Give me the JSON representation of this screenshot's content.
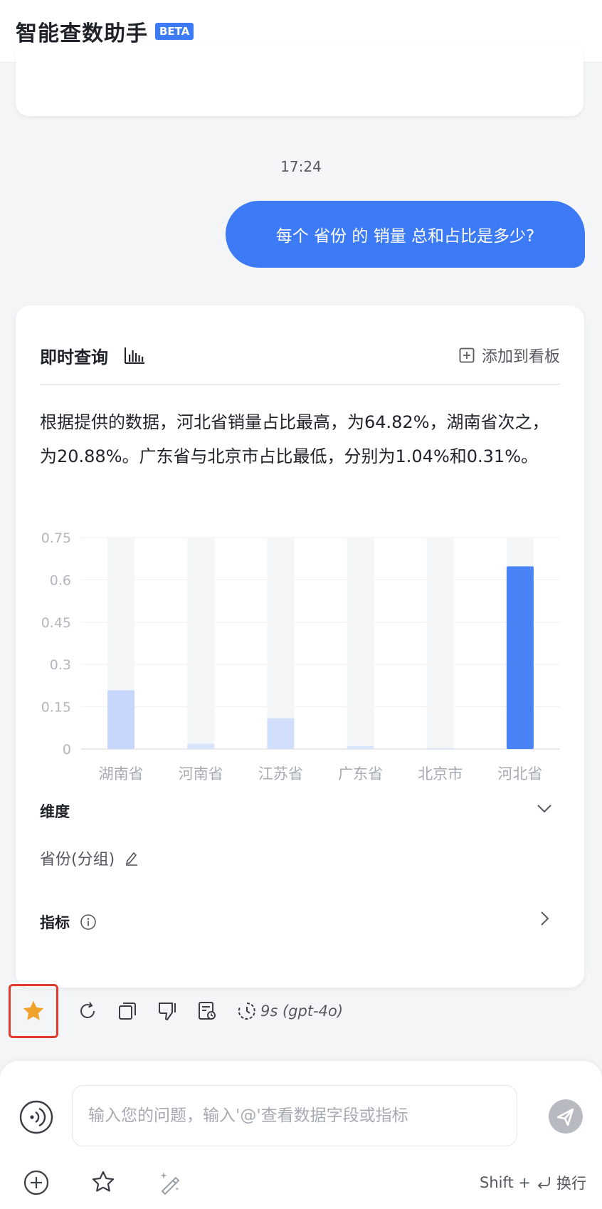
{
  "header": {
    "title": "智能查数助手",
    "badge": "BETA"
  },
  "conversation": {
    "timestamp": "17:24",
    "user_message": "每个 省份 的 销量 总和占比是多少?"
  },
  "answer_card": {
    "title": "即时查询",
    "title_icon": "bar-chart-icon",
    "add_to_board": "添加到看板",
    "summary": "根据提供的数据，河北省销量占比最高，为64.82%，湖南省次之，为20.88%。广东省与北京市占比最低，分别为1.04%和0.31%。",
    "dimension": {
      "label": "维度",
      "value": "省份(分组)"
    },
    "metric": {
      "label": "指标"
    }
  },
  "chart_data": {
    "type": "bar",
    "categories": [
      "湖南省",
      "河南省",
      "江苏省",
      "广东省",
      "北京市",
      "河北省"
    ],
    "values": [
      0.2088,
      0.019,
      0.1094,
      0.0104,
      0.0031,
      0.6482
    ],
    "y_ticks": [
      "0",
      "0.15",
      "0.3",
      "0.45",
      "0.6",
      "0.75"
    ],
    "ylim": [
      0,
      0.75
    ],
    "grid": true,
    "highlight_color": "#4a83f5",
    "bar_color": "#c6d7fb",
    "background_bar_color": "#f5f6f8"
  },
  "actions": {
    "timing": "9s (gpt-4o)",
    "icons": [
      "star-icon",
      "refresh-icon",
      "copy-icon",
      "thumbs-down-icon",
      "report-icon",
      "history-icon"
    ]
  },
  "composer": {
    "placeholder": "输入您的问题，输入'@'查看数据字段或指标",
    "hint_prefix": "Shift +",
    "hint_suffix": "换行"
  },
  "colors": {
    "accent": "#3d7af5",
    "highlight_box": "#e23b2e",
    "star": "#f0a22a"
  }
}
